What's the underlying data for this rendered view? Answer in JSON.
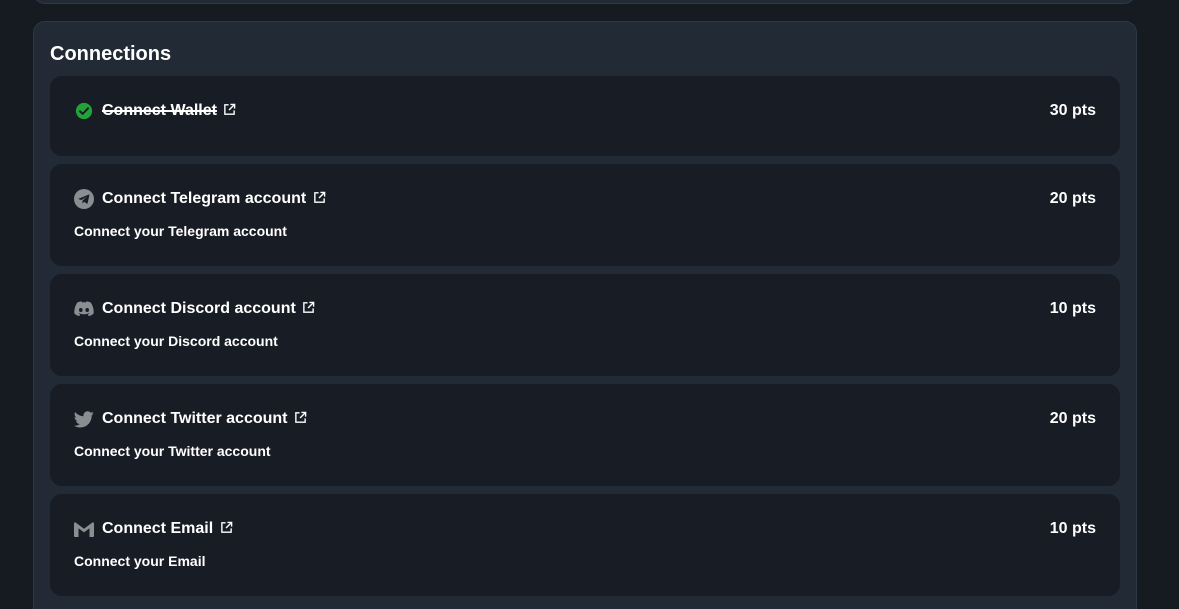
{
  "colors": {
    "background": "#161b22",
    "panel": "#212a35",
    "card": "#181c24",
    "text": "#ffffff",
    "icon_gray": "#8a8d91",
    "success": "#22a33a"
  },
  "connections": {
    "title": "Connections",
    "items": [
      {
        "title": "Connect Wallet",
        "description": "",
        "points": "30 pts",
        "icon": "check-circle-icon",
        "completed": true
      },
      {
        "title": "Connect Telegram account",
        "description": "Connect your Telegram account",
        "points": "20 pts",
        "icon": "telegram-icon",
        "completed": false
      },
      {
        "title": "Connect Discord account",
        "description": "Connect your Discord account",
        "points": "10 pts",
        "icon": "discord-icon",
        "completed": false
      },
      {
        "title": "Connect Twitter account",
        "description": "Connect your Twitter account",
        "points": "20 pts",
        "icon": "twitter-icon",
        "completed": false
      },
      {
        "title": "Connect Email",
        "description": "Connect your Email",
        "points": "10 pts",
        "icon": "gmail-icon",
        "completed": false
      }
    ]
  }
}
